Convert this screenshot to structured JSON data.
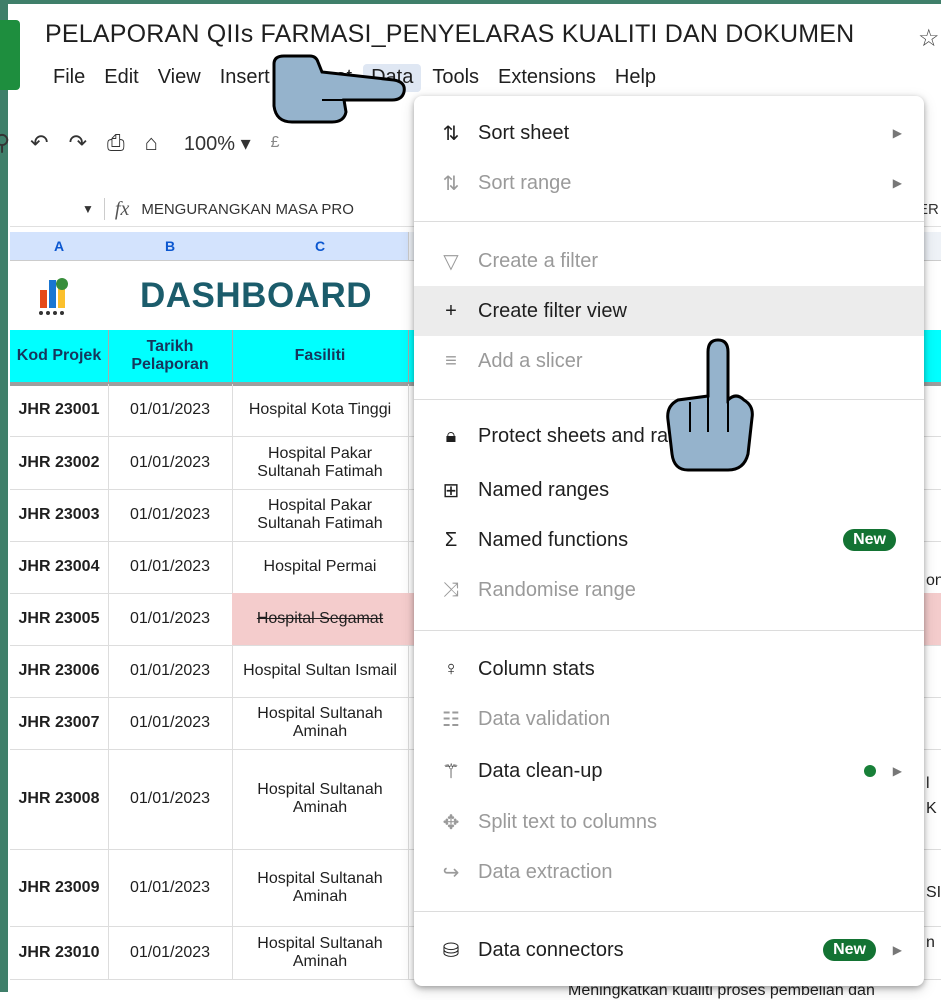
{
  "doc": {
    "title": "PELAPORAN QIIs FARMASI_PENYELARAS KUALITI DAN DOKUMEN"
  },
  "menubar": [
    "File",
    "Edit",
    "View",
    "Insert",
    "Format",
    "Data",
    "Tools",
    "Extensions",
    "Help"
  ],
  "toolbar": {
    "zoom": "100%",
    "currency": "£"
  },
  "formula_bar": {
    "content": "MENGURANGKAN MASA PRO",
    "right_fragment": "ER"
  },
  "columns": [
    "A",
    "B",
    "C"
  ],
  "sheet": {
    "dashboard_title": "DASHBOARD",
    "headers": {
      "kod": "Kod Projek",
      "tarikh": "Tarikh Pelaporan",
      "fasiliti": "Fasiliti"
    },
    "rows": [
      {
        "kod": "JHR 23001",
        "tarikh": "01/01/2023",
        "fasiliti": "Hospital Kota Tinggi"
      },
      {
        "kod": "JHR 23002",
        "tarikh": "01/01/2023",
        "fasiliti": "Hospital Pakar Sultanah Fatimah"
      },
      {
        "kod": "JHR 23003",
        "tarikh": "01/01/2023",
        "fasiliti": "Hospital Pakar Sultanah Fatimah"
      },
      {
        "kod": "JHR 23004",
        "tarikh": "01/01/2023",
        "fasiliti": "Hospital Permai"
      },
      {
        "kod": "JHR 23005",
        "tarikh": "01/01/2023",
        "fasiliti": "Hospital Segamat"
      },
      {
        "kod": "JHR 23006",
        "tarikh": "01/01/2023",
        "fasiliti": "Hospital Sultan Ismail"
      },
      {
        "kod": "JHR 23007",
        "tarikh": "01/01/2023",
        "fasiliti": "Hospital Sultanah Aminah"
      },
      {
        "kod": "JHR 23008",
        "tarikh": "01/01/2023",
        "fasiliti": "Hospital Sultanah Aminah"
      },
      {
        "kod": "JHR 23009",
        "tarikh": "01/01/2023",
        "fasiliti": "Hospital Sultanah Aminah"
      },
      {
        "kod": "JHR 23010",
        "tarikh": "01/01/2023",
        "fasiliti": "Hospital Sultanah Aminah"
      }
    ],
    "right_fragments": [
      "on",
      "l",
      "K",
      "SI",
      "n"
    ],
    "bottom_text": "Meningkatkan kualiti proses pembelian dan"
  },
  "data_menu": {
    "sort_sheet": "Sort sheet",
    "sort_range": "Sort range",
    "create_filter": "Create a filter",
    "create_filter_view": "Create filter view",
    "add_slicer": "Add a slicer",
    "protect": "Protect sheets and ranges",
    "named_ranges": "Named ranges",
    "named_functions": "Named functions",
    "randomise": "Randomise range",
    "column_stats": "Column stats",
    "data_validation": "Data validation",
    "data_cleanup": "Data clean-up",
    "split_text": "Split text to columns",
    "data_extraction": "Data extraction",
    "data_connectors": "Data connectors",
    "new_badge": "New"
  },
  "colors": {
    "header_cyan": "#00ffff",
    "title_teal": "#1b5c6b",
    "badge_green": "#137333",
    "highlight_row": "#f4cccc"
  }
}
